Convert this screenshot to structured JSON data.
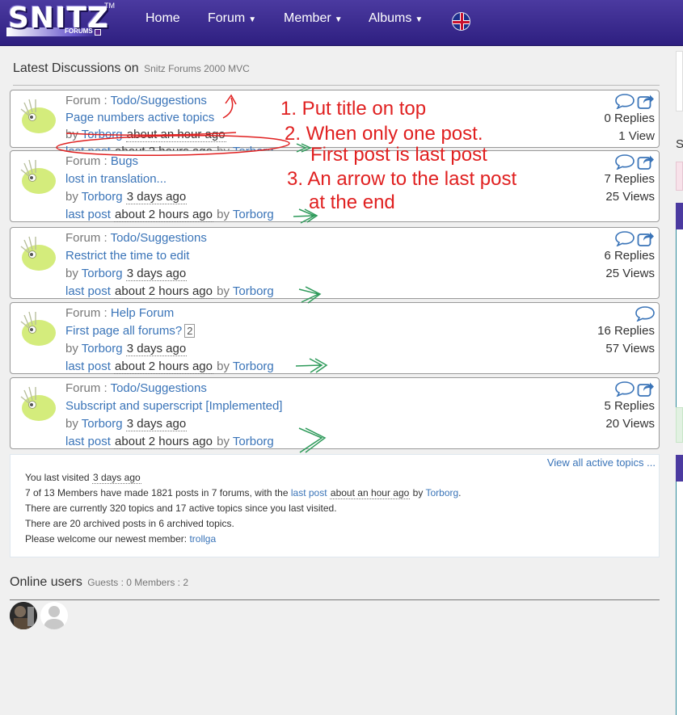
{
  "brand": {
    "name": "SNITZ",
    "sub": "FORUMS",
    "tm": "TM"
  },
  "nav": {
    "home": "Home",
    "forum": "Forum",
    "member": "Member",
    "albums": "Albums"
  },
  "latest": {
    "title": "Latest Discussions on",
    "site": "Snitz Forums 2000 MVC"
  },
  "topics": [
    {
      "forum_label": "Forum :",
      "forum": "Todo/Suggestions",
      "subject": "Page numbers active topics",
      "by": "by",
      "author": "Torborg",
      "posted": "about an hour ago",
      "lp_label": "last post",
      "lp_time": "about 2 hours ago",
      "lp_by": "by",
      "lp_author": "Torborg",
      "replies": "0 Replies",
      "views": "1 View"
    },
    {
      "forum_label": "Forum :",
      "forum": "Bugs",
      "subject": "lost in translation...",
      "by": "by",
      "author": "Torborg",
      "posted": "3 days ago",
      "lp_label": "last post",
      "lp_time": "about 2 hours ago",
      "lp_by": "by",
      "lp_author": "Torborg",
      "replies": "7 Replies",
      "views": "25 Views"
    },
    {
      "forum_label": "Forum :",
      "forum": "Todo/Suggestions",
      "subject": "Restrict the time to edit",
      "by": "by",
      "author": "Torborg",
      "posted": "3 days ago",
      "lp_label": "last post",
      "lp_time": "about 2 hours ago",
      "lp_by": "by",
      "lp_author": "Torborg",
      "replies": "6 Replies",
      "views": "25 Views"
    },
    {
      "forum_label": "Forum :",
      "forum": "Help Forum",
      "subject": "First page all forums?",
      "pages": "2",
      "by": "by",
      "author": "Torborg",
      "posted": "3 days ago",
      "lp_label": "last post",
      "lp_time": "about 2 hours ago",
      "lp_by": "by",
      "lp_author": "Torborg",
      "replies": "16 Replies",
      "views": "57 Views"
    },
    {
      "forum_label": "Forum :",
      "forum": "Todo/Suggestions",
      "subject": "Subscript and superscript [Implemented]",
      "by": "by",
      "author": "Torborg",
      "posted": "3 days ago",
      "lp_label": "last post",
      "lp_time": "about 2 hours ago",
      "lp_by": "by",
      "lp_author": "Torborg",
      "replies": "5 Replies",
      "views": "20 Views"
    }
  ],
  "info": {
    "view_all": "View all active topics ...",
    "visited_label": "You last visited",
    "visited_time": "3 days ago",
    "members_text": "7 of 13 Members have made 1821 posts in 7 forums, with the",
    "last_post_link": "last post",
    "last_post_time": "about an hour ago",
    "by": "by",
    "last_post_author": "Torborg",
    "topics_line": "There are currently 320 topics and 17 active topics since you last visited.",
    "archived_line": "There are 20 archived posts in 6 archived topics.",
    "welcome_label": "Please welcome our newest member:",
    "newest_member": "trollga"
  },
  "online": {
    "title": "Online users",
    "counts": "Guests : 0 Members : 2"
  },
  "sidebar": {
    "letter": "S"
  },
  "annotations": {
    "line1": "1. Put title on top",
    "line2": "2. When only one post.",
    "line2b": "First post is last post",
    "line3": "3. An arrow to the last post",
    "line3b": "at the end"
  },
  "colors": {
    "navbar": "#3b2d94",
    "link": "#3a74b8",
    "annotation_red": "#e02020",
    "annotation_green": "#2e9a5a"
  }
}
